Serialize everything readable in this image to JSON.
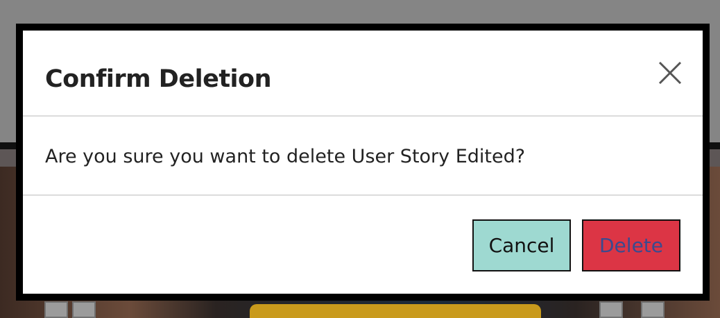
{
  "modal": {
    "title": "Confirm Deletion",
    "message": "Are you sure you want to delete User Story Edited?",
    "cancel_label": "Cancel",
    "delete_label": "Delete",
    "close_icon": "close-icon"
  },
  "colors": {
    "cancel_bg": "#9ed9d1",
    "delete_bg": "#dc3545",
    "delete_text": "#3b4a8f",
    "overlay": "#858585"
  }
}
